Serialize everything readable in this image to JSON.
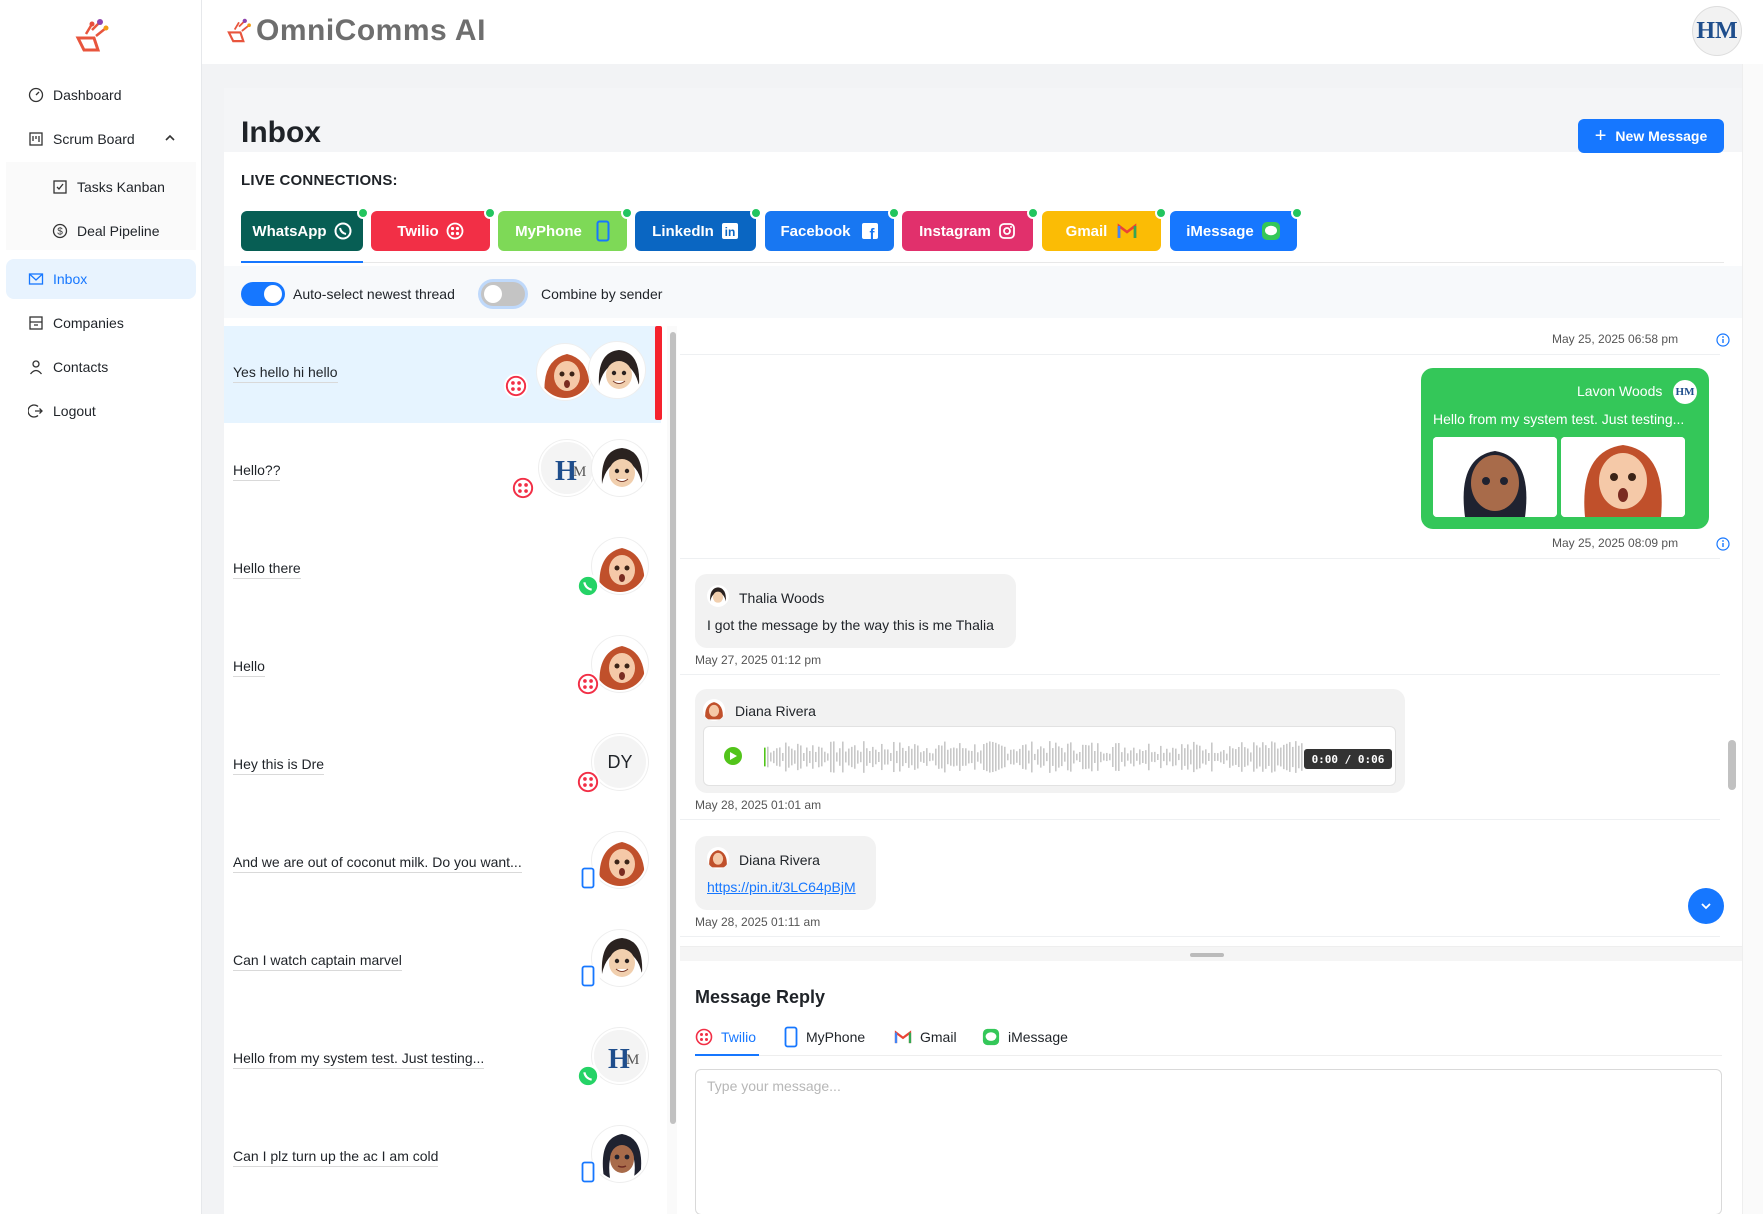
{
  "app": {
    "brand": "OmniComms AI",
    "avatar_initials": "HM"
  },
  "sidebar": {
    "items": [
      {
        "label": "Dashboard",
        "icon": "dashboard-icon"
      },
      {
        "label": "Scrum Board",
        "icon": "board-icon",
        "expanded": true
      },
      {
        "label": "Tasks Kanban",
        "icon": "checkbox-icon"
      },
      {
        "label": "Deal Pipeline",
        "icon": "dollar-icon"
      },
      {
        "label": "Inbox",
        "icon": "mail-icon",
        "active": true
      },
      {
        "label": "Companies",
        "icon": "building-icon"
      },
      {
        "label": "Contacts",
        "icon": "user-icon"
      },
      {
        "label": "Logout",
        "icon": "logout-icon"
      }
    ]
  },
  "page": {
    "title": "Inbox",
    "new_message_label": "New Message"
  },
  "live": {
    "label": "LIVE CONNECTIONS:",
    "channels": [
      {
        "label": "WhatsApp",
        "color": "#075e54"
      },
      {
        "label": "Twilio",
        "color": "#f22f46"
      },
      {
        "label": "MyPhone",
        "color": "#7ed957"
      },
      {
        "label": "LinkedIn",
        "color": "#0a66c2"
      },
      {
        "label": "Facebook",
        "color": "#1877f2"
      },
      {
        "label": "Instagram",
        "color": "#e1306c"
      },
      {
        "label": "Gmail",
        "color": "#fbbc05"
      },
      {
        "label": "iMessage",
        "color": "#1677ff"
      }
    ]
  },
  "toggles": {
    "auto_select": {
      "label": "Auto-select newest thread",
      "on": true
    },
    "combine": {
      "label": "Combine by sender",
      "on": false
    }
  },
  "threads": [
    {
      "preview": "Yes hello hi hello",
      "channel": "twilio",
      "selected": true
    },
    {
      "preview": "Hello??",
      "channel": "twilio"
    },
    {
      "preview": "Hello there",
      "channel": "whatsapp"
    },
    {
      "preview": "Hello",
      "channel": "twilio"
    },
    {
      "preview": "Hey this is Dre",
      "channel": "twilio",
      "initials": "DY"
    },
    {
      "preview": "And we are out of coconut milk. Do you want...",
      "channel": "myphone"
    },
    {
      "preview": "Can I watch captain marvel",
      "channel": "myphone"
    },
    {
      "preview": "Hello from my system test. Just testing...",
      "channel": "whatsapp"
    },
    {
      "preview": "Can I plz turn up the ac I am cold",
      "channel": "myphone"
    }
  ],
  "conversation": {
    "messages": [
      {
        "timestamp": "May 25, 2025 06:58 pm"
      },
      {
        "sender": "Lavon Woods",
        "text": "Hello from my system test. Just testing...",
        "timestamp": "May 25, 2025 08:09 pm",
        "avatar": "HM"
      },
      {
        "sender": "Thalia Woods",
        "text": "I got the message by the way this is me Thalia",
        "timestamp": "May 27, 2025 01:12 pm"
      },
      {
        "sender": "Diana Rivera",
        "audio_time": "0:00 / 0:06",
        "timestamp": "May 28, 2025 01:01 am"
      },
      {
        "sender": "Diana Rivera",
        "link": "https://pin.it/3LC64pBjM",
        "timestamp": "May 28, 2025 01:11 am"
      }
    ]
  },
  "reply": {
    "title": "Message Reply",
    "tabs": [
      {
        "label": "Twilio",
        "active": true
      },
      {
        "label": "MyPhone"
      },
      {
        "label": "Gmail"
      },
      {
        "label": "iMessage"
      }
    ],
    "placeholder": "Type your message..."
  }
}
